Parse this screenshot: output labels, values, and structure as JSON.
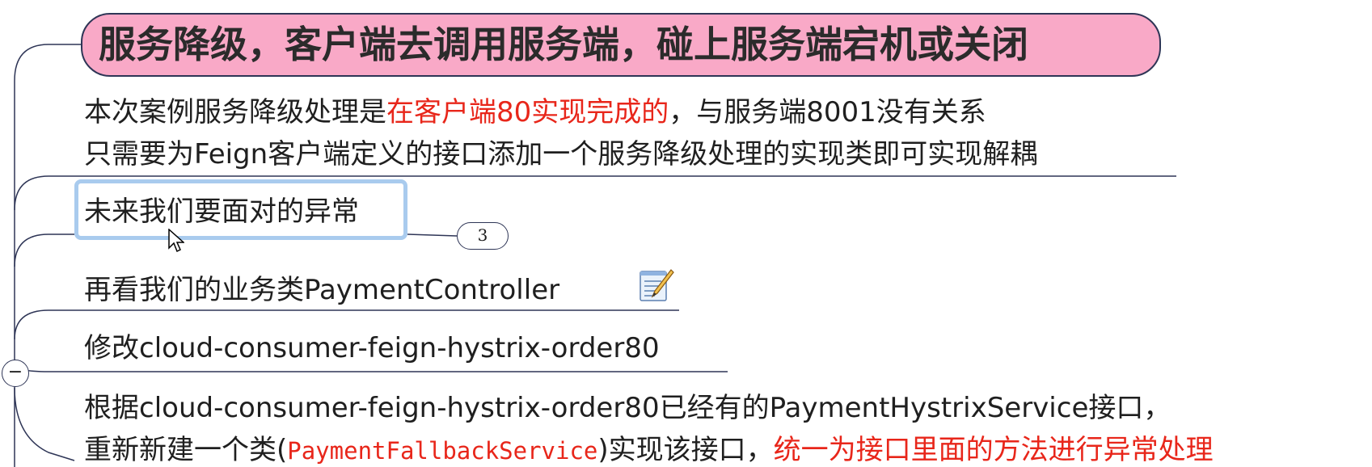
{
  "topic": {
    "title": "服务降级，客户端去调用服务端，碰上服务端宕机或关闭"
  },
  "nodes": {
    "case_note": {
      "line1_a": "本次案例服务降级处理是",
      "line1_red": "在客户端80实现完成的",
      "line1_b": "，与服务端8001没有关系",
      "line2": "只需要为Feign客户端定义的接口添加一个服务降级处理的实现类即可实现解耦"
    },
    "future_exceptions": {
      "label": "未来我们要面对的异常",
      "collapsed_count": "3"
    },
    "payment_controller": {
      "label": "再看我们的业务类PaymentController",
      "icon": "note-edit-icon"
    },
    "modify_module": {
      "label": "修改cloud-consumer-feign-hystrix-order80"
    },
    "fallback_impl": {
      "line1": "根据cloud-consumer-feign-hystrix-order80已经有的PaymentHystrixService接口，",
      "line2_a": "重新新建一个类(",
      "line2_code": "PaymentFallbackService",
      "line2_b": ")实现该接口，",
      "line2_red": "统一为接口里面的方法进行异常处理"
    }
  },
  "controls": {
    "collapse_symbol": "−",
    "icon_names": [
      "collapse-icon",
      "cursor-pointer-icon",
      "note-edit-icon"
    ]
  },
  "colors": {
    "title_fill": "#f9a9c7",
    "title_border": "#2e3556",
    "highlight_text": "#e8261a",
    "selection_border": "#a9cbee",
    "connector": "#2e3556"
  }
}
